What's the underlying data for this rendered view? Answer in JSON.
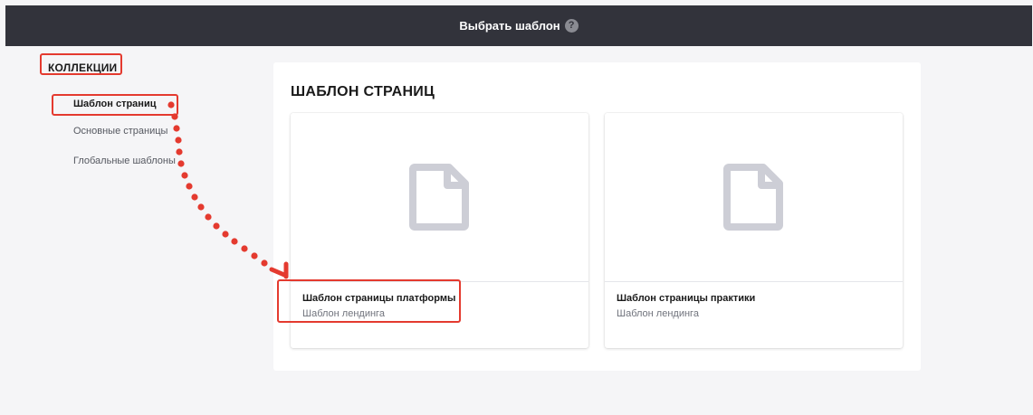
{
  "header": {
    "title": "Выбрать шаблон",
    "help_icon": "question-circle-icon"
  },
  "sidebar": {
    "title": "КОЛЛЕКЦИИ",
    "items": [
      {
        "label": "Шаблон страниц",
        "active": true
      },
      {
        "label": "Основные страницы",
        "active": false
      },
      {
        "label": "Глобальные шаблоны",
        "active": false
      }
    ]
  },
  "main": {
    "title": "ШАБЛОН СТРАНИЦ",
    "cards": [
      {
        "name": "Шаблон страницы платформы",
        "type": "Шаблон лендинга",
        "icon": "file-icon"
      },
      {
        "name": "Шаблон страницы практики",
        "type": "Шаблон лендинга",
        "icon": "file-icon"
      }
    ]
  },
  "colors": {
    "header_bg": "#32333b",
    "annotation": "#e43a2f",
    "file_icon": "#cdced6"
  }
}
